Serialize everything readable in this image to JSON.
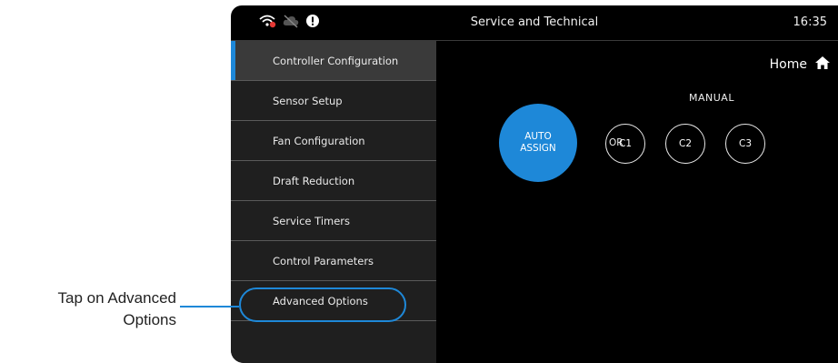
{
  "header": {
    "title": "Service and Technical",
    "time": "16:35"
  },
  "status_icons": [
    "wifi-alert-icon",
    "cloud-off-icon",
    "info-icon"
  ],
  "sidebar": {
    "items": [
      {
        "label": "Controller Configuration",
        "active": true
      },
      {
        "label": "Sensor Setup"
      },
      {
        "label": "Fan Configuration"
      },
      {
        "label": "Draft Reduction"
      },
      {
        "label": "Service Timers"
      },
      {
        "label": "Control Parameters"
      },
      {
        "label": "Advanced Options"
      }
    ]
  },
  "main": {
    "home_label": "Home",
    "manual_label": "MANUAL",
    "auto_assign": {
      "line1": "AUTO",
      "line2": "ASSIGN"
    },
    "or_label": "OR",
    "channels": [
      "C1",
      "C2",
      "C3"
    ]
  },
  "callout": {
    "line1": "Tap on Advanced",
    "line2": "Options"
  },
  "colors": {
    "accent": "#1e88d8",
    "background": "#000000",
    "sidebar": "#1f1f1f",
    "active": "#3a3a3a"
  }
}
